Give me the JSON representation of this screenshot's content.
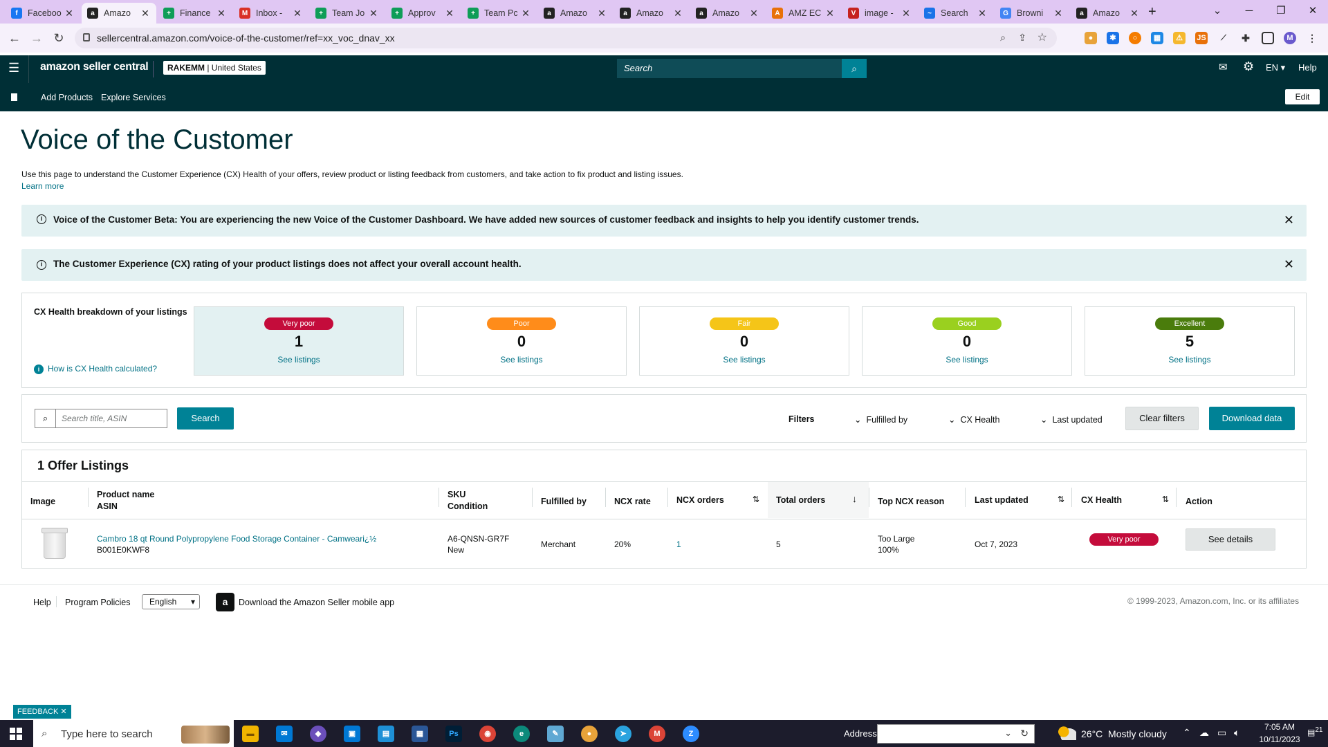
{
  "browser": {
    "tabs": [
      {
        "title": "Faceboo",
        "icon": "facebook-icon",
        "color": "#1877f2",
        "glyph": "f"
      },
      {
        "title": "Amazo",
        "icon": "amazon-icon",
        "color": "#222222",
        "glyph": "a",
        "active": true
      },
      {
        "title": "Finance",
        "icon": "sheets-icon",
        "color": "#0f9d58",
        "glyph": "+"
      },
      {
        "title": "Inbox -",
        "icon": "gmail-icon",
        "color": "#d93025",
        "glyph": "M"
      },
      {
        "title": "Team Jo",
        "icon": "sheets-icon",
        "color": "#0f9d58",
        "glyph": "+"
      },
      {
        "title": "Approv",
        "icon": "sheets-icon",
        "color": "#0f9d58",
        "glyph": "+"
      },
      {
        "title": "Team Pc",
        "icon": "sheets-icon",
        "color": "#0f9d58",
        "glyph": "+"
      },
      {
        "title": "Amazo",
        "icon": "amazon-icon",
        "color": "#222222",
        "glyph": "a"
      },
      {
        "title": "Amazo",
        "icon": "amazon-icon",
        "color": "#222222",
        "glyph": "a"
      },
      {
        "title": "Amazo",
        "icon": "amazon-icon",
        "color": "#222222",
        "glyph": "a"
      },
      {
        "title": "AMZ EC",
        "icon": "amz-ec-icon",
        "color": "#e8710a",
        "glyph": "A"
      },
      {
        "title": "image -",
        "icon": "image-search-icon",
        "color": "#c5221f",
        "glyph": "V"
      },
      {
        "title": "Search",
        "icon": "search-tab-icon",
        "color": "#1a73e8",
        "glyph": "~"
      },
      {
        "title": "Browni",
        "icon": "google-icon",
        "color": "#4285f4",
        "glyph": "G"
      },
      {
        "title": "Amazo",
        "icon": "amazon-icon",
        "color": "#222222",
        "glyph": "a"
      }
    ],
    "url": "sellercentral.amazon.com/voice-of-the-customer/ref=xx_voc_dnav_xx",
    "profile_initial": "M"
  },
  "seller": {
    "logo": "amazon seller central",
    "account": "RAKEMM",
    "marketplace": "United States",
    "search_placeholder": "Search",
    "language": "EN",
    "help": "Help",
    "nav": [
      "Add Products",
      "Explore Services"
    ],
    "edit": "Edit"
  },
  "page": {
    "title": "Voice of the Customer",
    "description": "Use this page to understand the Customer Experience (CX) Health of your offers, review product or listing feedback from customers, and take action to fix product and listing issues.",
    "learn_more": "Learn more",
    "banner1": "Voice of the Customer Beta: You are experiencing the new Voice of the Customer Dashboard. We have added new sources of customer feedback and insights to help you identify customer trends.",
    "banner2": "The Customer Experience (CX) rating of your product listings does not affect your overall account health."
  },
  "cx_health": {
    "heading": "CX Health breakdown of your listings",
    "how_link": "How is CX Health calculated?",
    "cards": [
      {
        "label": "Very poor",
        "count": "1",
        "link": "See listings",
        "color": "#c40c3b"
      },
      {
        "label": "Poor",
        "count": "0",
        "link": "See listings",
        "color": "#ff8c1a"
      },
      {
        "label": "Fair",
        "count": "0",
        "link": "See listings",
        "color": "#f5c518"
      },
      {
        "label": "Good",
        "count": "0",
        "link": "See listings",
        "color": "#9ad01f"
      },
      {
        "label": "Excellent",
        "count": "5",
        "link": "See listings",
        "color": "#4a7c0c"
      }
    ]
  },
  "filters": {
    "search_placeholder": "Search title, ASIN",
    "search_button": "Search",
    "label": "Filters",
    "fulfilled_by": "Fulfilled by",
    "cx_health": "CX Health",
    "last_updated": "Last updated",
    "clear": "Clear filters",
    "download": "Download data"
  },
  "listings": {
    "heading": "1 Offer Listings",
    "headers": {
      "image": "Image",
      "product_name": "Product name",
      "asin": "ASIN",
      "sku": "SKU",
      "condition": "Condition",
      "fulfilled_by": "Fulfilled by",
      "ncx_rate": "NCX rate",
      "ncx_orders": "NCX orders",
      "total_orders": "Total orders",
      "top_reason": "Top NCX reason",
      "last_updated": "Last updated",
      "cx_health": "CX Health",
      "action": "Action"
    },
    "rows": [
      {
        "product_name": "Cambro 18 qt Round Polypropylene Food Storage Container - Camweari¿½",
        "asin": "B001E0KWF8",
        "sku": "A6-QNSN-GR7F",
        "condition": "New",
        "fulfilled_by": "Merchant",
        "ncx_rate": "20%",
        "ncx_orders": "1",
        "total_orders": "5",
        "top_reason": "Too Large",
        "top_reason_pct": "100%",
        "last_updated": "Oct 7, 2023",
        "cx_health": "Very poor",
        "action": "See details"
      }
    ]
  },
  "footer": {
    "help": "Help",
    "policies": "Program Policies",
    "language": "English",
    "app": "Download the Amazon Seller mobile app",
    "copyright": "© 1999-2023, Amazon.com, Inc. or its affiliates",
    "feedback": "FEEDBACK"
  },
  "taskbar": {
    "search_placeholder": "Type here to search",
    "address_label": "Address",
    "weather": "26°C  Mostly cloudy",
    "time": "7:05 AM",
    "date": "10/11/2023",
    "notifications": "21"
  }
}
